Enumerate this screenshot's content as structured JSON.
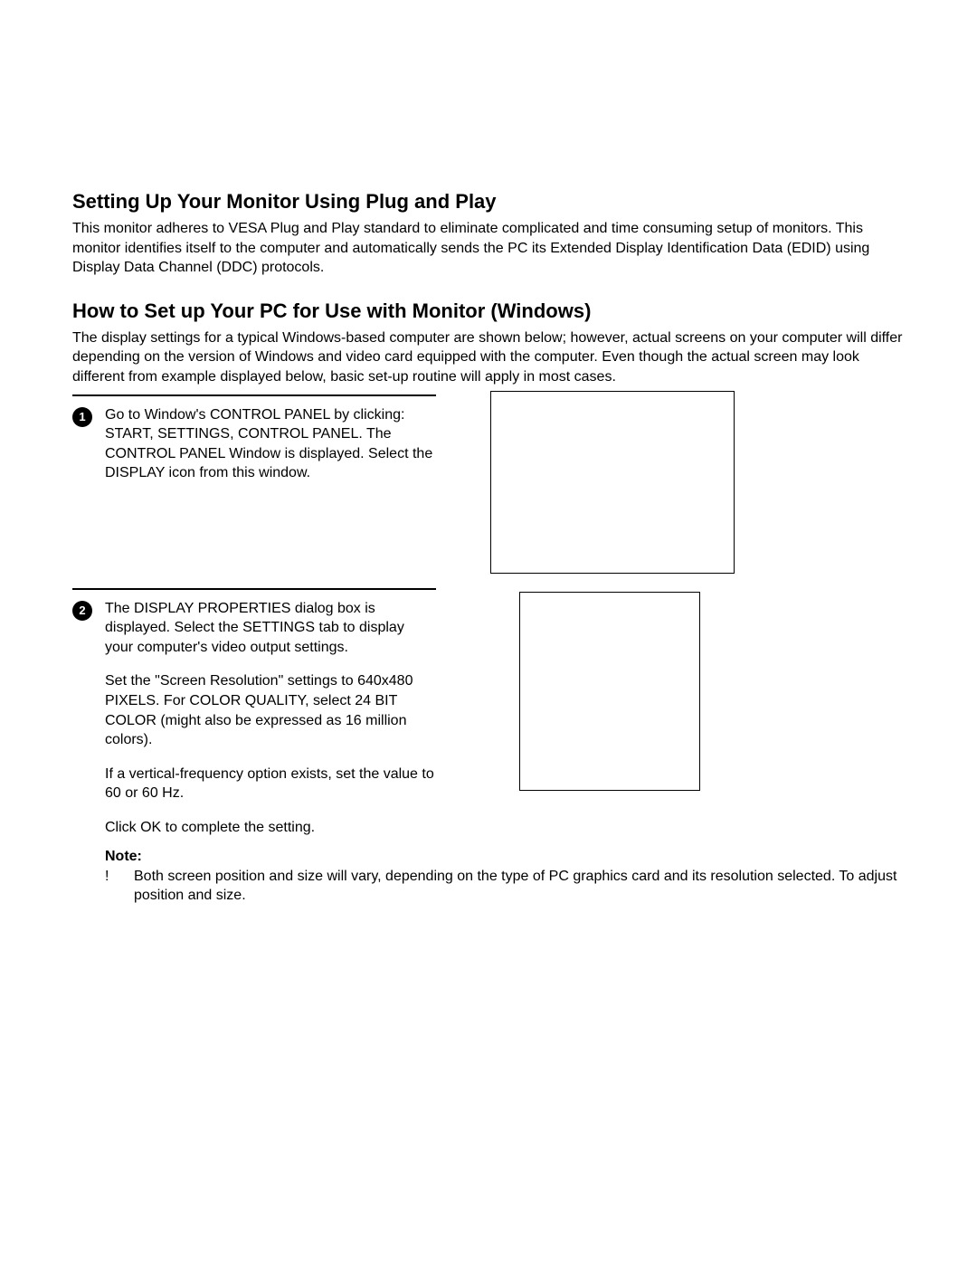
{
  "section1": {
    "heading": "Setting Up Your Monitor Using Plug and Play",
    "body": "This monitor adheres to VESA Plug and Play standard to eliminate complicated and time consuming setup of monitors.  This monitor identifies itself to the computer and automatically sends the PC its Extended Display Identification Data (EDID) using Display Data Channel (DDC) protocols."
  },
  "section2": {
    "heading": "How to Set up Your PC for Use with Monitor (Windows)",
    "body": "The display settings for a typical Windows-based computer are shown below; however, actual screens on your computer will differ depending on the version of Windows and video card equipped with the computer.  Even though the actual screen may look different from example displayed below, basic set-up routine will apply in most cases."
  },
  "step1": {
    "num": "1",
    "text": "Go to Window's CONTROL PANEL by clicking: START, SETTINGS, CONTROL PANEL.  The CONTROL PANEL Window is displayed.  Select the DISPLAY icon from this window."
  },
  "step2": {
    "num": "2",
    "p1": "The DISPLAY PROPERTIES dialog box is displayed.  Select the SETTINGS tab to display your computer's video output settings.",
    "p2": "Set the \"Screen Resolution\" settings  to 640x480 PIXELS.  For COLOR QUALITY, select  24 BIT COLOR (might also be expressed as 16 million colors).",
    "p3": "If a vertical-frequency option exists,  set the value to 60 or 60 Hz.",
    "p4": "Click OK to complete the setting."
  },
  "note": {
    "label": "Note:",
    "bullet": "!",
    "text": "Both screen position and size will vary, depending on the type of PC graphics card and its resolution selected.  To adjust position and size."
  }
}
